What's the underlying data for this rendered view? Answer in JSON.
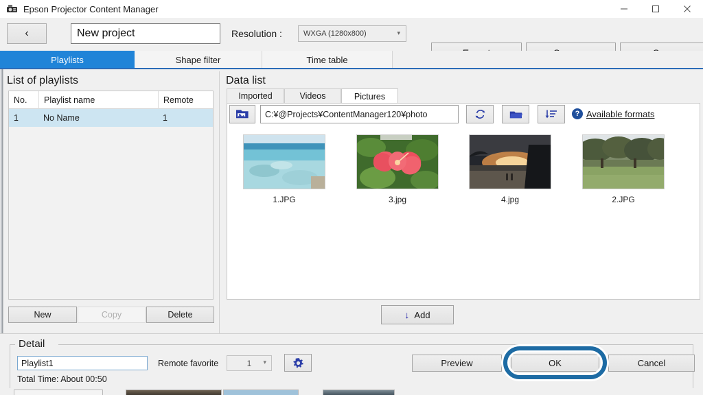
{
  "window": {
    "title": "Epson Projector Content Manager",
    "app_icon": "projector-icon",
    "minimize": "−",
    "maximize": "□",
    "close": "✕"
  },
  "toolbar": {
    "back_icon": "chevron-left-icon",
    "back_glyph": "‹",
    "project_name": "New project",
    "project_name_placeholder": "New project",
    "resolution_label": "Resolution :",
    "resolution_value": "WXGA (1280x800)",
    "resolution_options": [
      "WXGA (1280x800)"
    ],
    "export_label": "Export",
    "save_as_label": "Save as",
    "save_label": "Save"
  },
  "tabs": [
    {
      "label": "Playlists",
      "active": true
    },
    {
      "label": "Shape filter",
      "active": false
    },
    {
      "label": "Time table",
      "active": false
    }
  ],
  "playlists": {
    "section_title": "List of playlists",
    "columns": [
      "No.",
      "Playlist name",
      "Remote"
    ],
    "rows": [
      {
        "no": "1",
        "name": "No Name",
        "remote": "1",
        "selected": true
      }
    ],
    "buttons": {
      "new": "New",
      "copy": "Copy",
      "copy_disabled": true,
      "delete": "Delete"
    }
  },
  "data_list": {
    "section_title": "Data list",
    "subtabs": [
      {
        "label": "Imported",
        "active": false
      },
      {
        "label": "Videos",
        "active": false
      },
      {
        "label": "Pictures",
        "active": true
      }
    ],
    "browse_icon": "image-folder-icon",
    "path": "C:¥@Projects¥ContentManager120¥photo",
    "path_placeholder": "C:¥@Projects¥ContentManager120¥photo",
    "refresh_icon": "refresh-icon",
    "folder_icon": "folder-icon",
    "sort_icon": "sort-descending-icon",
    "help_icon": "help-icon",
    "help_glyph": "?",
    "available_formats_link": "Available formats",
    "thumbnails": [
      {
        "caption": "1.JPG",
        "alt": "ocean-reef-photo"
      },
      {
        "caption": "3.jpg",
        "alt": "pink-hibiscus-flower-photo"
      },
      {
        "caption": "4.jpg",
        "alt": "beach-sunset-photo"
      },
      {
        "caption": "2.JPG",
        "alt": "trees-lawn-photo"
      }
    ],
    "add_label": "Add",
    "add_icon": "arrow-down-icon",
    "add_glyph": "↓"
  },
  "detail": {
    "group_label": "Detail",
    "playlist_name": "Playlist1",
    "playlist_name_placeholder": "Playlist1",
    "remote_favorite_label": "Remote favorite",
    "remote_favorite_value": "1",
    "remote_favorite_options": [
      "1"
    ],
    "settings_icon": "gear-icon",
    "total_time": "Total Time: About 00:50"
  },
  "dialog_buttons": {
    "preview": "Preview",
    "ok": "OK",
    "cancel": "Cancel",
    "highlighted": "ok"
  },
  "colors": {
    "accent_tab": "#2084d8",
    "tab_underline": "#2b6cb8",
    "row_selected": "#cde5f2",
    "highlight_ring": "#1d6ba4",
    "window_bg": "#f0f0f0",
    "icon_blue": "#2020a8",
    "help_blue": "#1f4f9c"
  }
}
